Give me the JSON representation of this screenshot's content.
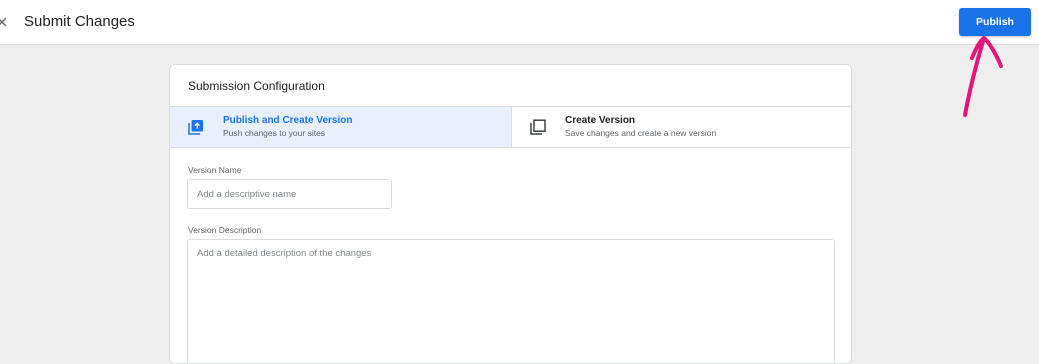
{
  "header": {
    "title": "Submit Changes",
    "publish_label": "Publish",
    "accent_color": "#1a73e8"
  },
  "annotation": {
    "arrow_color": "#e5157a"
  },
  "config": {
    "title": "Submission Configuration",
    "options": [
      {
        "title": "Publish and Create Version",
        "subtitle": "Push changes to your sites",
        "icon": "publish-upload-icon",
        "selected": true
      },
      {
        "title": "Create Version",
        "subtitle": "Save changes and create a new version",
        "icon": "version-copy-icon",
        "selected": false
      }
    ],
    "version_name": {
      "label": "Version Name",
      "placeholder": "Add a descriptive name",
      "value": ""
    },
    "version_description": {
      "label": "Version Description",
      "placeholder": "Add a detailed description of the changes",
      "value": ""
    }
  }
}
